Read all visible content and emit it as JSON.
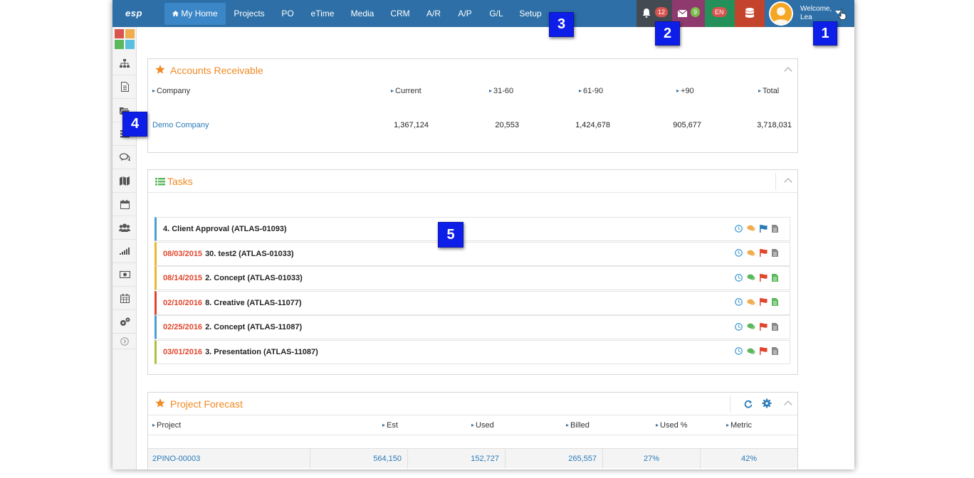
{
  "app": {
    "logo": "esp"
  },
  "nav": {
    "items": [
      {
        "label": "My Home",
        "active": true
      },
      {
        "label": "Projects"
      },
      {
        "label": "PO"
      },
      {
        "label": "eTime"
      },
      {
        "label": "Media"
      },
      {
        "label": "CRM"
      },
      {
        "label": "A/R"
      },
      {
        "label": "A/P"
      },
      {
        "label": "G/L"
      },
      {
        "label": "Setup"
      }
    ],
    "notifications_count": "12",
    "messages_count": "9",
    "language": "EN",
    "welcome": "Welcome,",
    "user": "Lea"
  },
  "callouts": [
    "1",
    "2",
    "3",
    "4",
    "5"
  ],
  "ar": {
    "title": "Accounts Receivable",
    "columns": [
      "Company",
      "Current",
      "31-60",
      "61-90",
      "+90",
      "Total"
    ],
    "rows": [
      {
        "company": "Demo Company",
        "current": "1,367,124",
        "d31_60": "20,553",
        "d61_90": "1,424,678",
        "d90": "905,677",
        "total": "3,718,031"
      }
    ]
  },
  "tasks": {
    "title": "Tasks",
    "items": [
      {
        "date": "",
        "text": "4. Client Approval (ATLAS-01093)",
        "color": "#4a9fd5"
      },
      {
        "date": "08/03/2015",
        "text": "30. test2 (ATLAS-01033)",
        "color": "#e8b830"
      },
      {
        "date": "08/14/2015",
        "text": "2. Concept (ATLAS-01033)",
        "color": "#e8b830"
      },
      {
        "date": "02/10/2016",
        "text": "8. Creative (ATLAS-11077)",
        "color": "#e0452b"
      },
      {
        "date": "02/25/2016",
        "text": "2. Concept (ATLAS-11087)",
        "color": "#4a9fd5"
      },
      {
        "date": "03/01/2016",
        "text": "3. Presentation (ATLAS-11087)",
        "color": "#a8c440"
      }
    ]
  },
  "forecast": {
    "title": "Project Forecast",
    "columns": [
      "Project",
      "Est",
      "Used",
      "Billed",
      "Used %",
      "Metric"
    ],
    "rows": [
      {
        "project": "2PINO-00003",
        "est": "564,150",
        "used": "152,727",
        "billed": "265,557",
        "used_pct": "27%",
        "metric": "42%"
      }
    ]
  },
  "colors": {
    "nav": "#2d6fa6",
    "accent": "#f08a24",
    "date_red": "#e0452b",
    "link": "#2a7ab8"
  }
}
